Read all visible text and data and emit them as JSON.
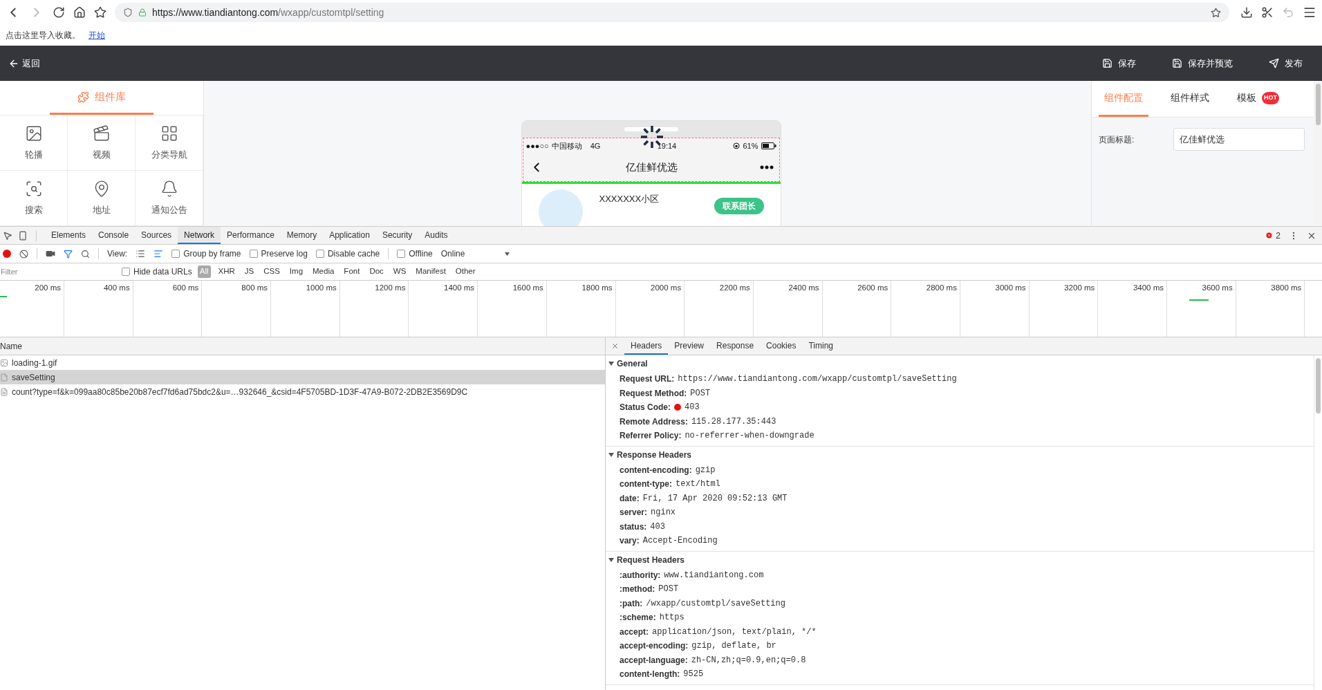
{
  "browser": {
    "url_host": "https://www.tiandiantong.com",
    "url_path": "/wxapp/customtpl/setting",
    "bookmark_hint": "点击这里导入收藏。",
    "bookmark_link": "开始"
  },
  "app_header": {
    "back": "返回",
    "actions": [
      {
        "label": "保存",
        "kind": "save"
      },
      {
        "label": "保存并预览",
        "kind": "save"
      },
      {
        "label": "发布",
        "kind": "send"
      }
    ]
  },
  "component_library": {
    "title": "组件库",
    "items": [
      {
        "label": "轮播",
        "kind": "image"
      },
      {
        "label": "视频",
        "kind": "video"
      },
      {
        "label": "分类导航",
        "kind": "grid"
      },
      {
        "label": "搜索",
        "kind": "search"
      },
      {
        "label": "地址",
        "kind": "pin"
      },
      {
        "label": "通知公告",
        "kind": "bell"
      }
    ]
  },
  "phone": {
    "signal": "●●●○○",
    "carrier": "中国移动",
    "network": "4G",
    "time": "19:14",
    "battery": "61%",
    "title": "亿佳鲜优选",
    "community": "XXXXXXX小区",
    "contact_button": "联系团长",
    "loading": true
  },
  "config_panel": {
    "tabs": [
      {
        "label": "组件配置",
        "selected": true
      },
      {
        "label": "组件样式",
        "selected": false
      },
      {
        "label": "模板",
        "selected": false,
        "badge": "HOT"
      }
    ],
    "field_label": "页面标题:",
    "field_value": "亿佳鲜优选"
  },
  "devtools": {
    "tabs": [
      {
        "label": "Elements",
        "selected": false
      },
      {
        "label": "Console",
        "selected": false
      },
      {
        "label": "Sources",
        "selected": false
      },
      {
        "label": "Network",
        "selected": true
      },
      {
        "label": "Performance",
        "selected": false
      },
      {
        "label": "Memory",
        "selected": false
      },
      {
        "label": "Application",
        "selected": false
      },
      {
        "label": "Security",
        "selected": false
      },
      {
        "label": "Audits",
        "selected": false
      }
    ],
    "error_count": "2",
    "toolbar": {
      "recording": true,
      "filter_on": true,
      "view_label": "View:",
      "views": [
        {
          "kind": "list",
          "selected": false
        },
        {
          "kind": "waterfall",
          "selected": true
        }
      ],
      "options": [
        {
          "label": "Group by frame",
          "checked": false
        },
        {
          "label": "Preserve log",
          "checked": false
        },
        {
          "label": "Disable cache",
          "checked": false
        },
        {
          "label": "Offline",
          "checked": false
        }
      ],
      "throttle": "Online"
    },
    "filter": {
      "placeholder": "Filter",
      "hide_data_urls": {
        "label": "Hide data URLs",
        "checked": false
      },
      "types": [
        {
          "label": "All",
          "selected": true
        },
        {
          "label": "XHR",
          "selected": false
        },
        {
          "label": "JS",
          "selected": false
        },
        {
          "label": "CSS",
          "selected": false
        },
        {
          "label": "Img",
          "selected": false
        },
        {
          "label": "Media",
          "selected": false
        },
        {
          "label": "Font",
          "selected": false
        },
        {
          "label": "Doc",
          "selected": false
        },
        {
          "label": "WS",
          "selected": false
        },
        {
          "label": "Manifest",
          "selected": false
        },
        {
          "label": "Other",
          "selected": false
        }
      ]
    },
    "timeline_ticks": [
      "200 ms",
      "400 ms",
      "600 ms",
      "800 ms",
      "1000 ms",
      "1200 ms",
      "1400 ms",
      "1600 ms",
      "1800 ms",
      "2000 ms",
      "2200 ms",
      "2400 ms",
      "2600 ms",
      "2800 ms",
      "3000 ms",
      "3200 ms",
      "3400 ms",
      "3600 ms",
      "3800 ms"
    ],
    "requests": {
      "column": "Name",
      "rows": [
        {
          "name": "loading-1.gif",
          "kind": "image",
          "selected": false
        },
        {
          "name": "saveSetting",
          "kind": "blank",
          "selected": true
        },
        {
          "name": "count?type=f&k=099aa80c85be20b87ecf7fd6ad75bdc2&u=…932646_&csid=4F5705BD-1D3F-47A9-B072-2DB2E3569D9C",
          "kind": "document",
          "selected": false
        }
      ]
    },
    "detail": {
      "tabs": [
        {
          "label": "Headers",
          "selected": true
        },
        {
          "label": "Preview",
          "selected": false
        },
        {
          "label": "Response",
          "selected": false
        },
        {
          "label": "Cookies",
          "selected": false
        },
        {
          "label": "Timing",
          "selected": false
        }
      ],
      "sections": [
        {
          "title": "General",
          "expanded": true,
          "rows": [
            {
              "key": "Request URL:",
              "value": "https://www.tiandiantong.com/wxapp/customtpl/saveSetting"
            },
            {
              "key": "Request Method:",
              "value": "POST"
            },
            {
              "key": "Status Code:",
              "value": "403",
              "color": "#e3140f"
            },
            {
              "key": "Remote Address:",
              "value": "115.28.177.35:443"
            },
            {
              "key": "Referrer Policy:",
              "value": "no-referrer-when-downgrade"
            }
          ]
        },
        {
          "title": "Response Headers",
          "expanded": true,
          "rows": [
            {
              "key": "content-encoding:",
              "value": "gzip"
            },
            {
              "key": "content-type:",
              "value": "text/html"
            },
            {
              "key": "date:",
              "value": "Fri, 17 Apr 2020 09:52:13 GMT"
            },
            {
              "key": "server:",
              "value": "nginx"
            },
            {
              "key": "status:",
              "value": "403"
            },
            {
              "key": "vary:",
              "value": "Accept-Encoding"
            }
          ]
        },
        {
          "title": "Request Headers",
          "expanded": true,
          "rows": [
            {
              "key": ":authority:",
              "value": "www.tiandiantong.com"
            },
            {
              "key": ":method:",
              "value": "POST"
            },
            {
              "key": ":path:",
              "value": "/wxapp/customtpl/saveSetting"
            },
            {
              "key": ":scheme:",
              "value": "https"
            },
            {
              "key": "accept:",
              "value": "application/json, text/plain, */*"
            },
            {
              "key": "accept-encoding:",
              "value": "gzip, deflate, br"
            },
            {
              "key": "accept-language:",
              "value": "zh-CN,zh;q=0.9,en;q=0.8"
            },
            {
              "key": "content-length:",
              "value": "9525"
            }
          ]
        }
      ]
    }
  }
}
